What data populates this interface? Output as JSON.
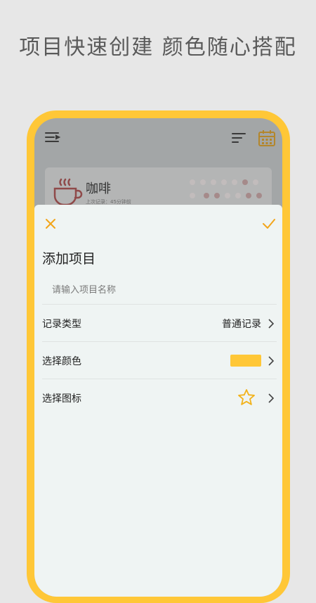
{
  "headline": "项目快速创建  颜色随心搭配",
  "colors": {
    "accent": "#f2a51a",
    "frame": "#ffc737",
    "swatch": "#ffc737",
    "overlay": "#a3a6a7",
    "sheet_bg": "#eff4f3"
  },
  "appbar": {
    "menu_icon": "menu-list-icon",
    "sort_icon": "sort-icon",
    "calendar_icon": "calendar-icon"
  },
  "background_card": {
    "icon": "coffee-cup-icon",
    "name": "咖啡",
    "subtitle": "上次记录：45分钟前"
  },
  "sheet": {
    "close_icon": "close-icon",
    "confirm_icon": "check-icon",
    "title": "添加项目",
    "name_input": {
      "placeholder": "请输入项目名称",
      "value": ""
    },
    "rows": {
      "type": {
        "label": "记录类型",
        "value": "普通记录"
      },
      "color": {
        "label": "选择颜色",
        "value_color": "#ffc737"
      },
      "icon": {
        "label": "选择图标",
        "value_icon": "star-icon"
      }
    }
  }
}
